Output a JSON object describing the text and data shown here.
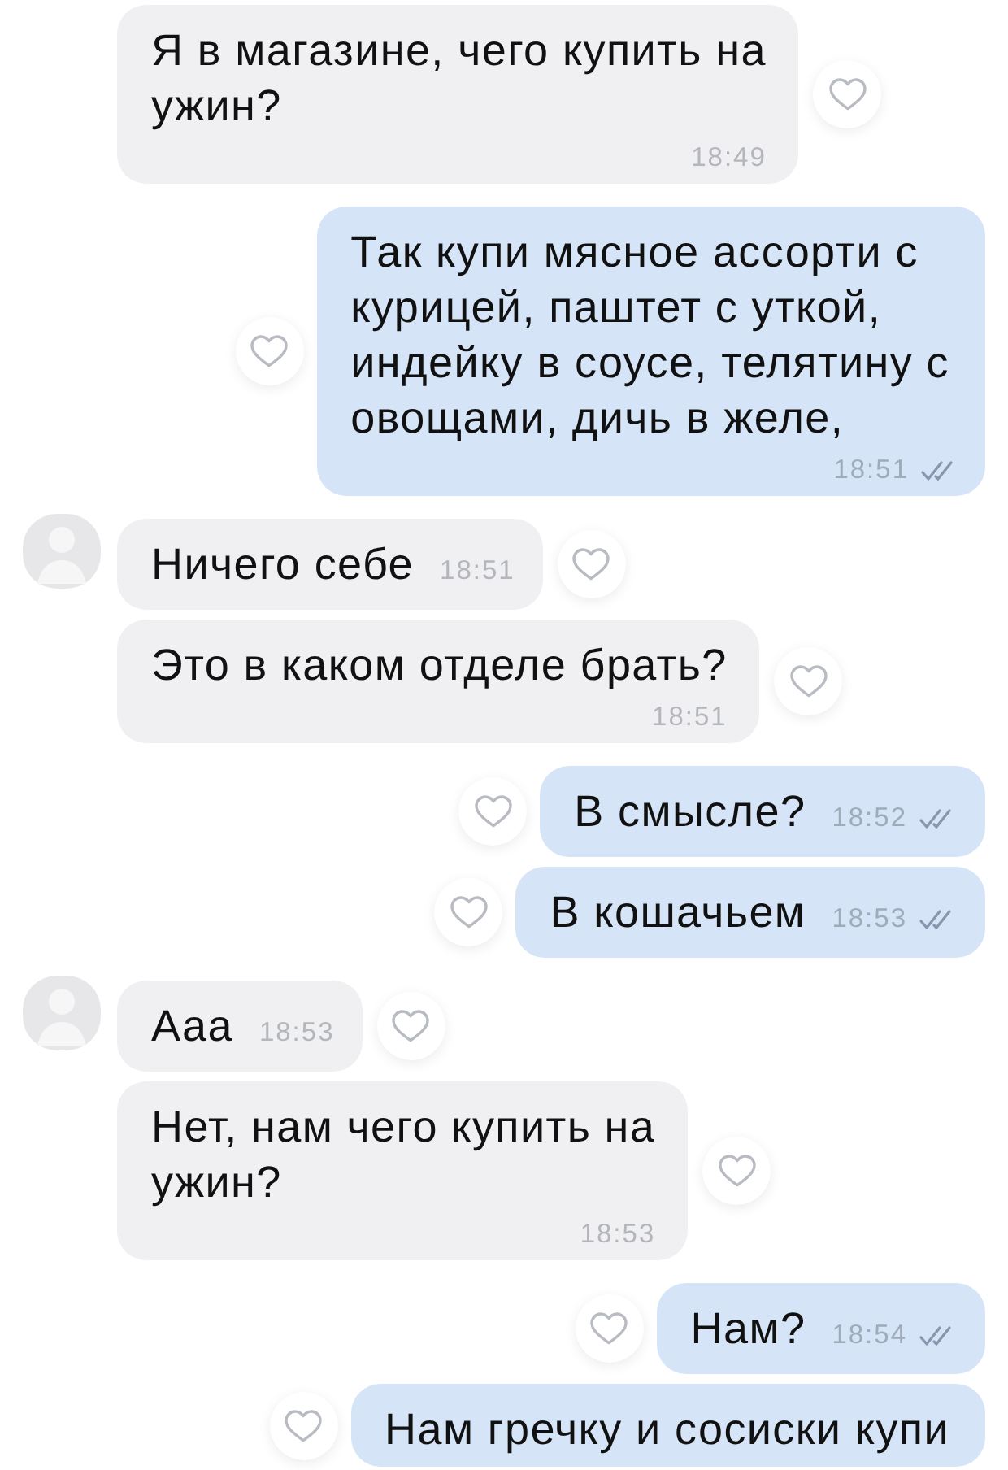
{
  "messages": [
    {
      "kind": "incoming",
      "avatar": false,
      "lines": [
        "Я в магазине, чего купить на",
        "ужин?"
      ],
      "time": "18:49",
      "liked": false
    },
    {
      "kind": "outgoing",
      "lines": [
        "Так купи мясное ассорти с",
        "курицей, паштет с уткой,",
        "индейку в соусе, телятину с",
        "овощами, дичь в желе,"
      ],
      "time": "18:51",
      "read": true,
      "liked": false
    },
    {
      "kind": "incoming",
      "avatar": true,
      "lines": [
        "Ничего себе"
      ],
      "time": "18:51",
      "liked": false
    },
    {
      "kind": "incoming",
      "avatar": false,
      "lines": [
        "Это в каком отделе брать?"
      ],
      "time": "18:51",
      "liked": false
    },
    {
      "kind": "outgoing",
      "lines": [
        "В смысле?"
      ],
      "time": "18:52",
      "read": true,
      "liked": false
    },
    {
      "kind": "outgoing",
      "lines": [
        "В кошачьем"
      ],
      "time": "18:53",
      "read": true,
      "liked": false
    },
    {
      "kind": "incoming",
      "avatar": true,
      "lines": [
        "Ааа"
      ],
      "time": "18:53",
      "liked": false
    },
    {
      "kind": "incoming",
      "avatar": false,
      "lines": [
        "Нет, нам чего купить на",
        "ужин?"
      ],
      "time": "18:53",
      "liked": false
    },
    {
      "kind": "outgoing",
      "lines": [
        "Нам?"
      ],
      "time": "18:54",
      "read": true,
      "liked": false
    },
    {
      "kind": "outgoing",
      "lines": [
        "Нам гречку и сосиски купи"
      ],
      "liked": false
    }
  ]
}
